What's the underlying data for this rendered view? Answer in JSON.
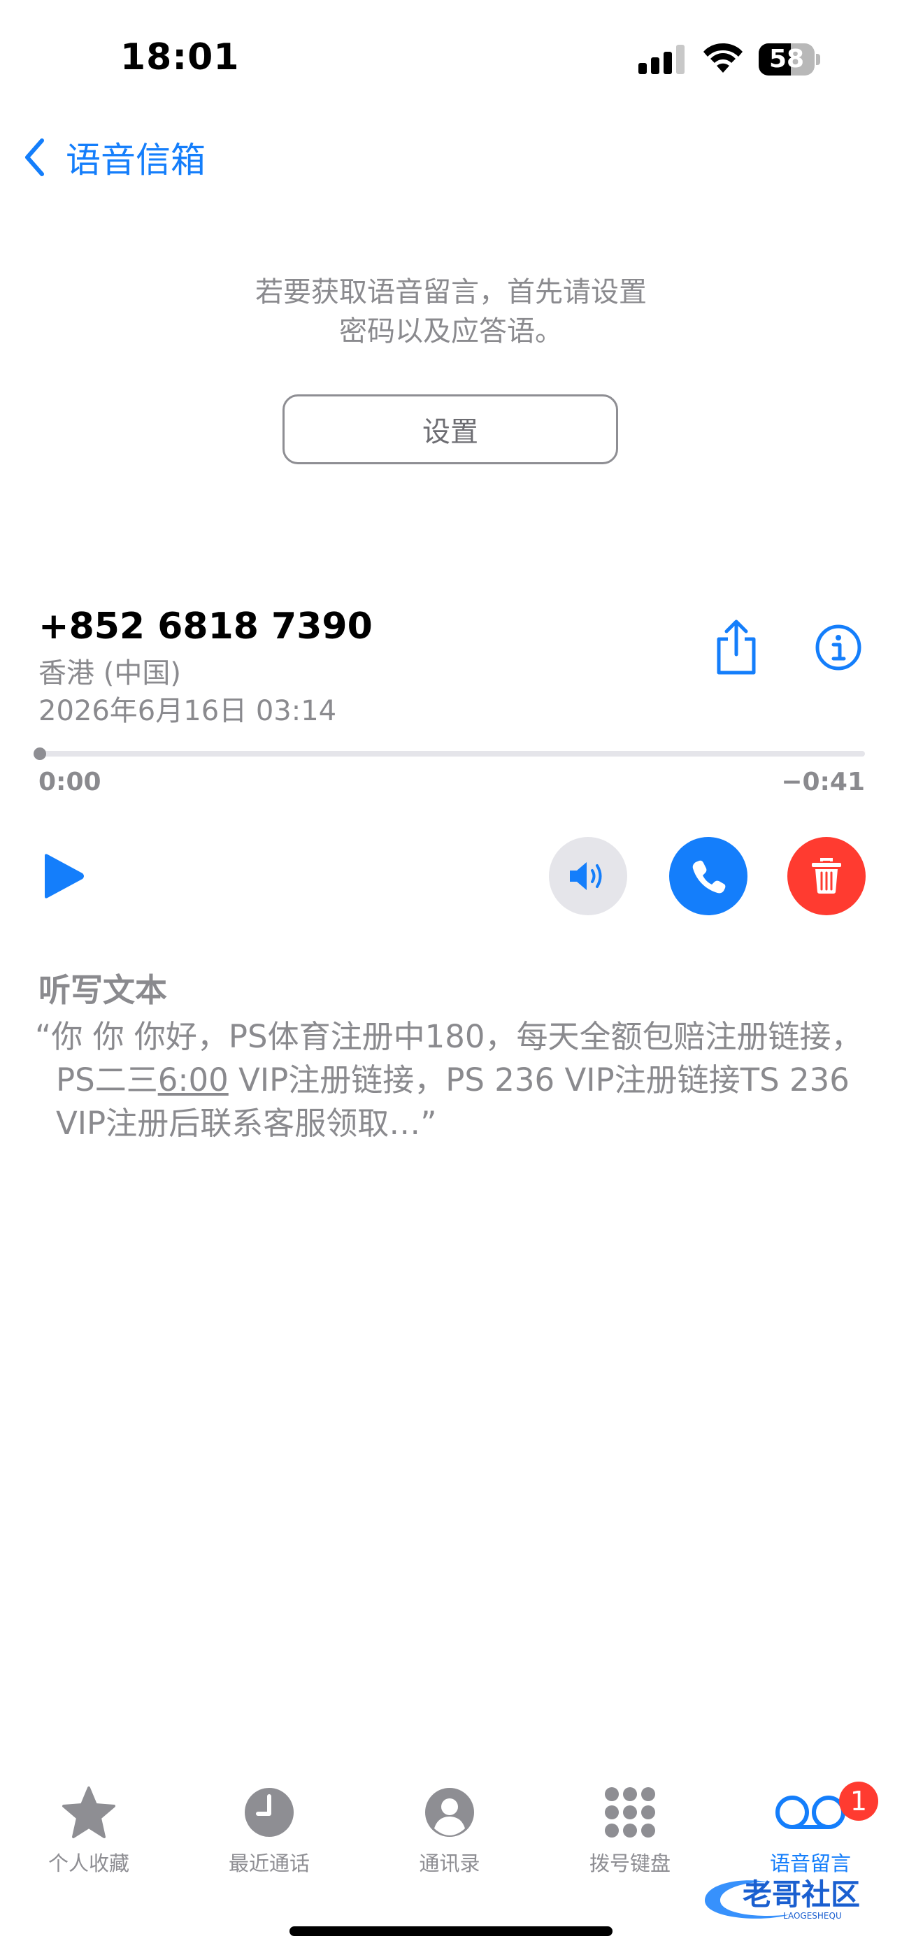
{
  "status_bar": {
    "time": "18:01",
    "battery": "58",
    "battery_level": 0.58
  },
  "nav": {
    "back_label": "语音信箱",
    "back_icon": "chevron-left-icon"
  },
  "setup": {
    "message_line1": "若要获取语音留言，首先请设置",
    "message_line2": "密码以及应答语。",
    "button_label": "设置"
  },
  "voicemail": {
    "caller": "+852 6818 7390",
    "region": "香港 (中国)",
    "date": "2026年6月16日 03:14",
    "elapsed": "0:00",
    "remaining": "−0:41",
    "progress": 0.0,
    "icons": {
      "share": "share-icon",
      "info": "info-icon",
      "play": "play-icon",
      "speaker": "speaker-icon",
      "call": "phone-icon",
      "delete": "trash-icon"
    }
  },
  "transcription": {
    "title": "听写文本",
    "text_before": "“你 你 你好，PS体育注册中180，每天全额包赔注册链接，PS二三",
    "text_underlined": "6:00",
    "text_after": " VIP注册链接，PS 236 VIP注册链接TS 236 VIP注册后联系客服领取…”"
  },
  "tab_bar": {
    "items": [
      {
        "label": "个人收藏",
        "icon": "star-icon"
      },
      {
        "label": "最近通话",
        "icon": "clock-icon"
      },
      {
        "label": "通讯录",
        "icon": "contact-icon"
      },
      {
        "label": "拨号键盘",
        "icon": "keypad-icon"
      },
      {
        "label": "语音留言",
        "icon": "voicemail-icon"
      }
    ],
    "active": "语音留言",
    "badge": "1"
  },
  "watermark": {
    "text": "老哥社区",
    "subtext": "LAOGESHEQU"
  },
  "colors": {
    "accent": "#147EFB",
    "destructive": "#FF3B30",
    "secondary_text": "#8a8a8e"
  }
}
